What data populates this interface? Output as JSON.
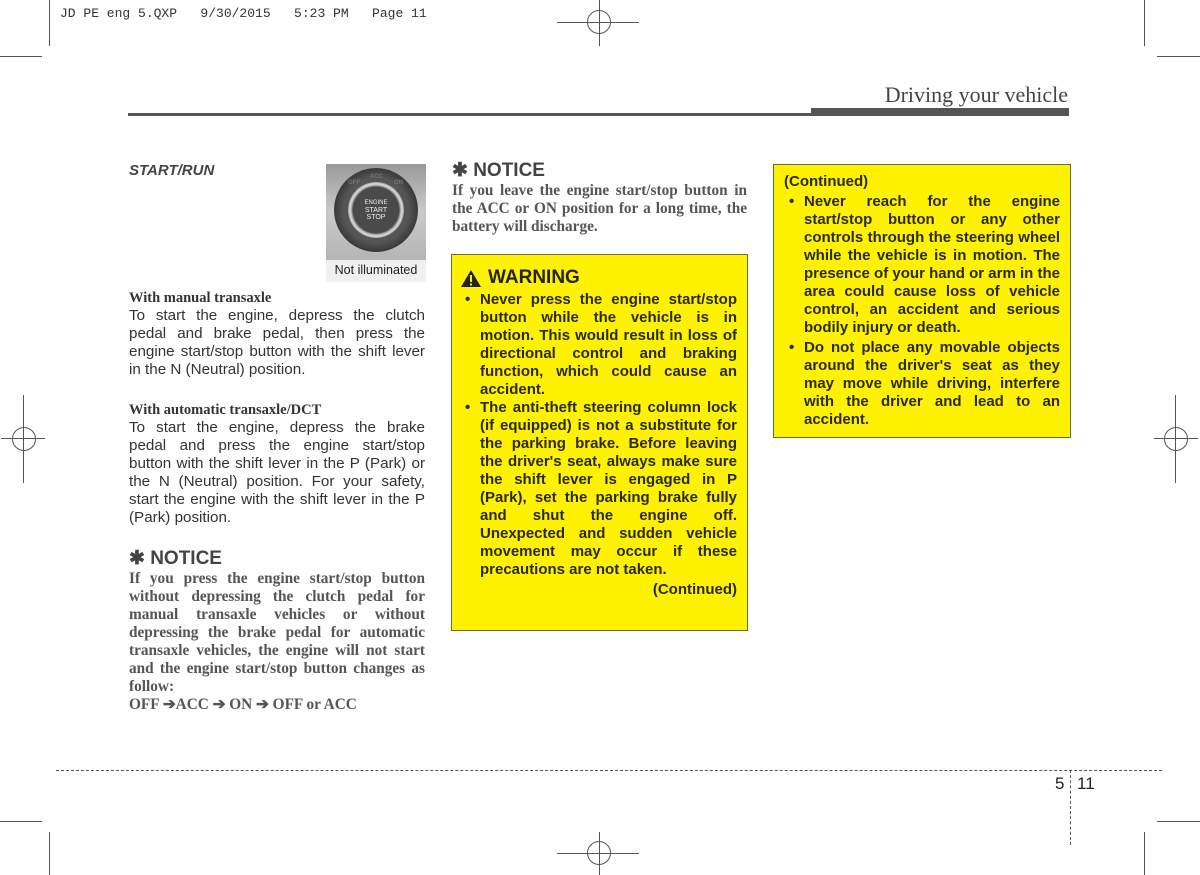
{
  "slug": "JD PE eng 5.QXP   9/30/2015   5:23 PM   Page 11",
  "header": {
    "title": "Driving your vehicle"
  },
  "column1": {
    "section_label": "START/RUN",
    "figure": {
      "ring_labels": [
        "OFF",
        "ACC",
        "ON"
      ],
      "button_lines": [
        "ENGINE",
        "START",
        "STOP"
      ],
      "caption": "Not illuminated"
    },
    "manual": {
      "heading": "With manual transaxle",
      "text": "To start the engine, depress the clutch pedal and brake pedal, then press the engine start/stop button with the shift lever in the N (Neutral) position."
    },
    "automatic": {
      "heading": "With automatic transaxle/DCT",
      "text": "To start the engine, depress the brake pedal and press the engine start/stop button with the shift lever in the P (Park) or the N (Neutral) position. For your safety, start the engine with the shift lever in the P (Park) position."
    },
    "notice": {
      "icon": "asterisk-icon",
      "title": "✱ NOTICE",
      "text": "If you press the engine start/stop button without depressing the clutch pedal for manual transaxle vehicles or without depressing the brake pedal for automatic transaxle vehicles, the engine will not start and the engine start/stop button changes as follow:",
      "sequence": "OFF ➔ACC ➔ ON ➔ OFF or ACC"
    }
  },
  "column2": {
    "notice": {
      "title": "✱ NOTICE",
      "text": "If you leave the engine start/stop button in the ACC or ON position for a long time, the battery will discharge."
    },
    "warning": {
      "icon": "warning-triangle-icon",
      "title": "WARNING",
      "items": [
        "Never press the engine start/stop button while the vehicle is in motion. This would result in loss of directional control and braking function, which could cause an accident.",
        "The anti-theft steering column lock (if equipped) is not a substitute for the parking brake. Before leaving the driver's seat, always make sure the shift lever is engaged in P (Park), set the parking brake fully and shut the engine off. Unexpected and sudden vehicle movement may occur if these precautions are not taken."
      ],
      "continued": "(Continued)"
    }
  },
  "column3": {
    "warning": {
      "continued": "(Continued)",
      "items": [
        "Never reach for the engine start/stop button or any other controls through the steering wheel while the vehicle is in motion. The presence of your hand or arm in the area could cause loss of vehicle control, an accident and serious bodily injury or death.",
        "Do not place any movable objects around the driver's seat as they may move while driving, interfere with the driver and lead to an accident."
      ]
    }
  },
  "footer": {
    "chapter": "5",
    "page": "11"
  },
  "colors": {
    "warning_bg": "#fff200",
    "rule": "#555555",
    "text": "#333333"
  }
}
